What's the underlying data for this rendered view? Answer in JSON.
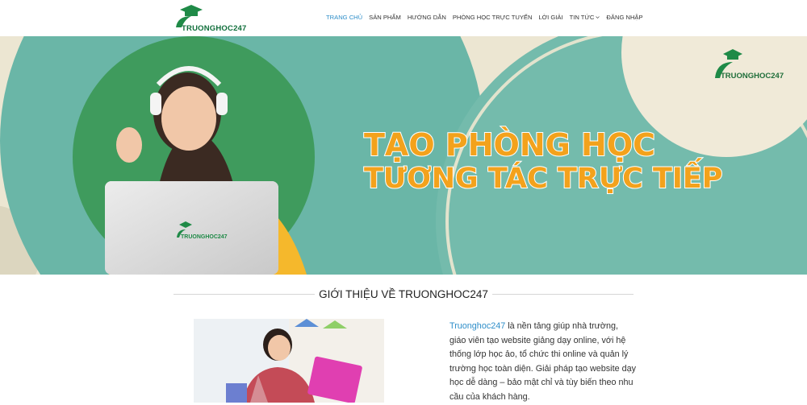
{
  "header": {
    "logo_text": "TRUONGHOC247",
    "nav": [
      {
        "label": "TRANG CHỦ",
        "active": true
      },
      {
        "label": "SẢN PHẨM"
      },
      {
        "label": "HƯỚNG DẪN"
      },
      {
        "label": "PHÒNG HỌC TRỰC TUYẾN"
      },
      {
        "label": "LỜI GIẢI"
      },
      {
        "label": "TIN TỨC",
        "has_dropdown": true
      },
      {
        "label": "ĐĂNG NHẬP"
      }
    ]
  },
  "hero": {
    "headline_line1": "TẠO PHÒNG HỌC",
    "headline_line2": "TƯƠNG TÁC TRỰC TIẾP",
    "brand_text": "TRUONGHOC247",
    "laptop_brand": "TRUONGHOC247",
    "slide_count": 3,
    "active_slide": 3
  },
  "intro": {
    "title": "GIỚI THIỆU VỀ TRUONGHOC247",
    "brand": "Truonghoc247",
    "text": " là nền tảng giúp nhà trường, giáo viên tạo website giảng dạy online, với hệ thống lớp học ảo, tổ chức thi online và quản lý trường học toàn diện. Giải pháp tạo website dạy học dễ dàng – bảo mật chỉ và tùy biến theo nhu cầu của khách hàng."
  },
  "colors": {
    "accent_blue": "#2e8ec9",
    "teal": "#6ab6a7",
    "green": "#3f9b5d",
    "headline_orange": "#f3a21c"
  }
}
